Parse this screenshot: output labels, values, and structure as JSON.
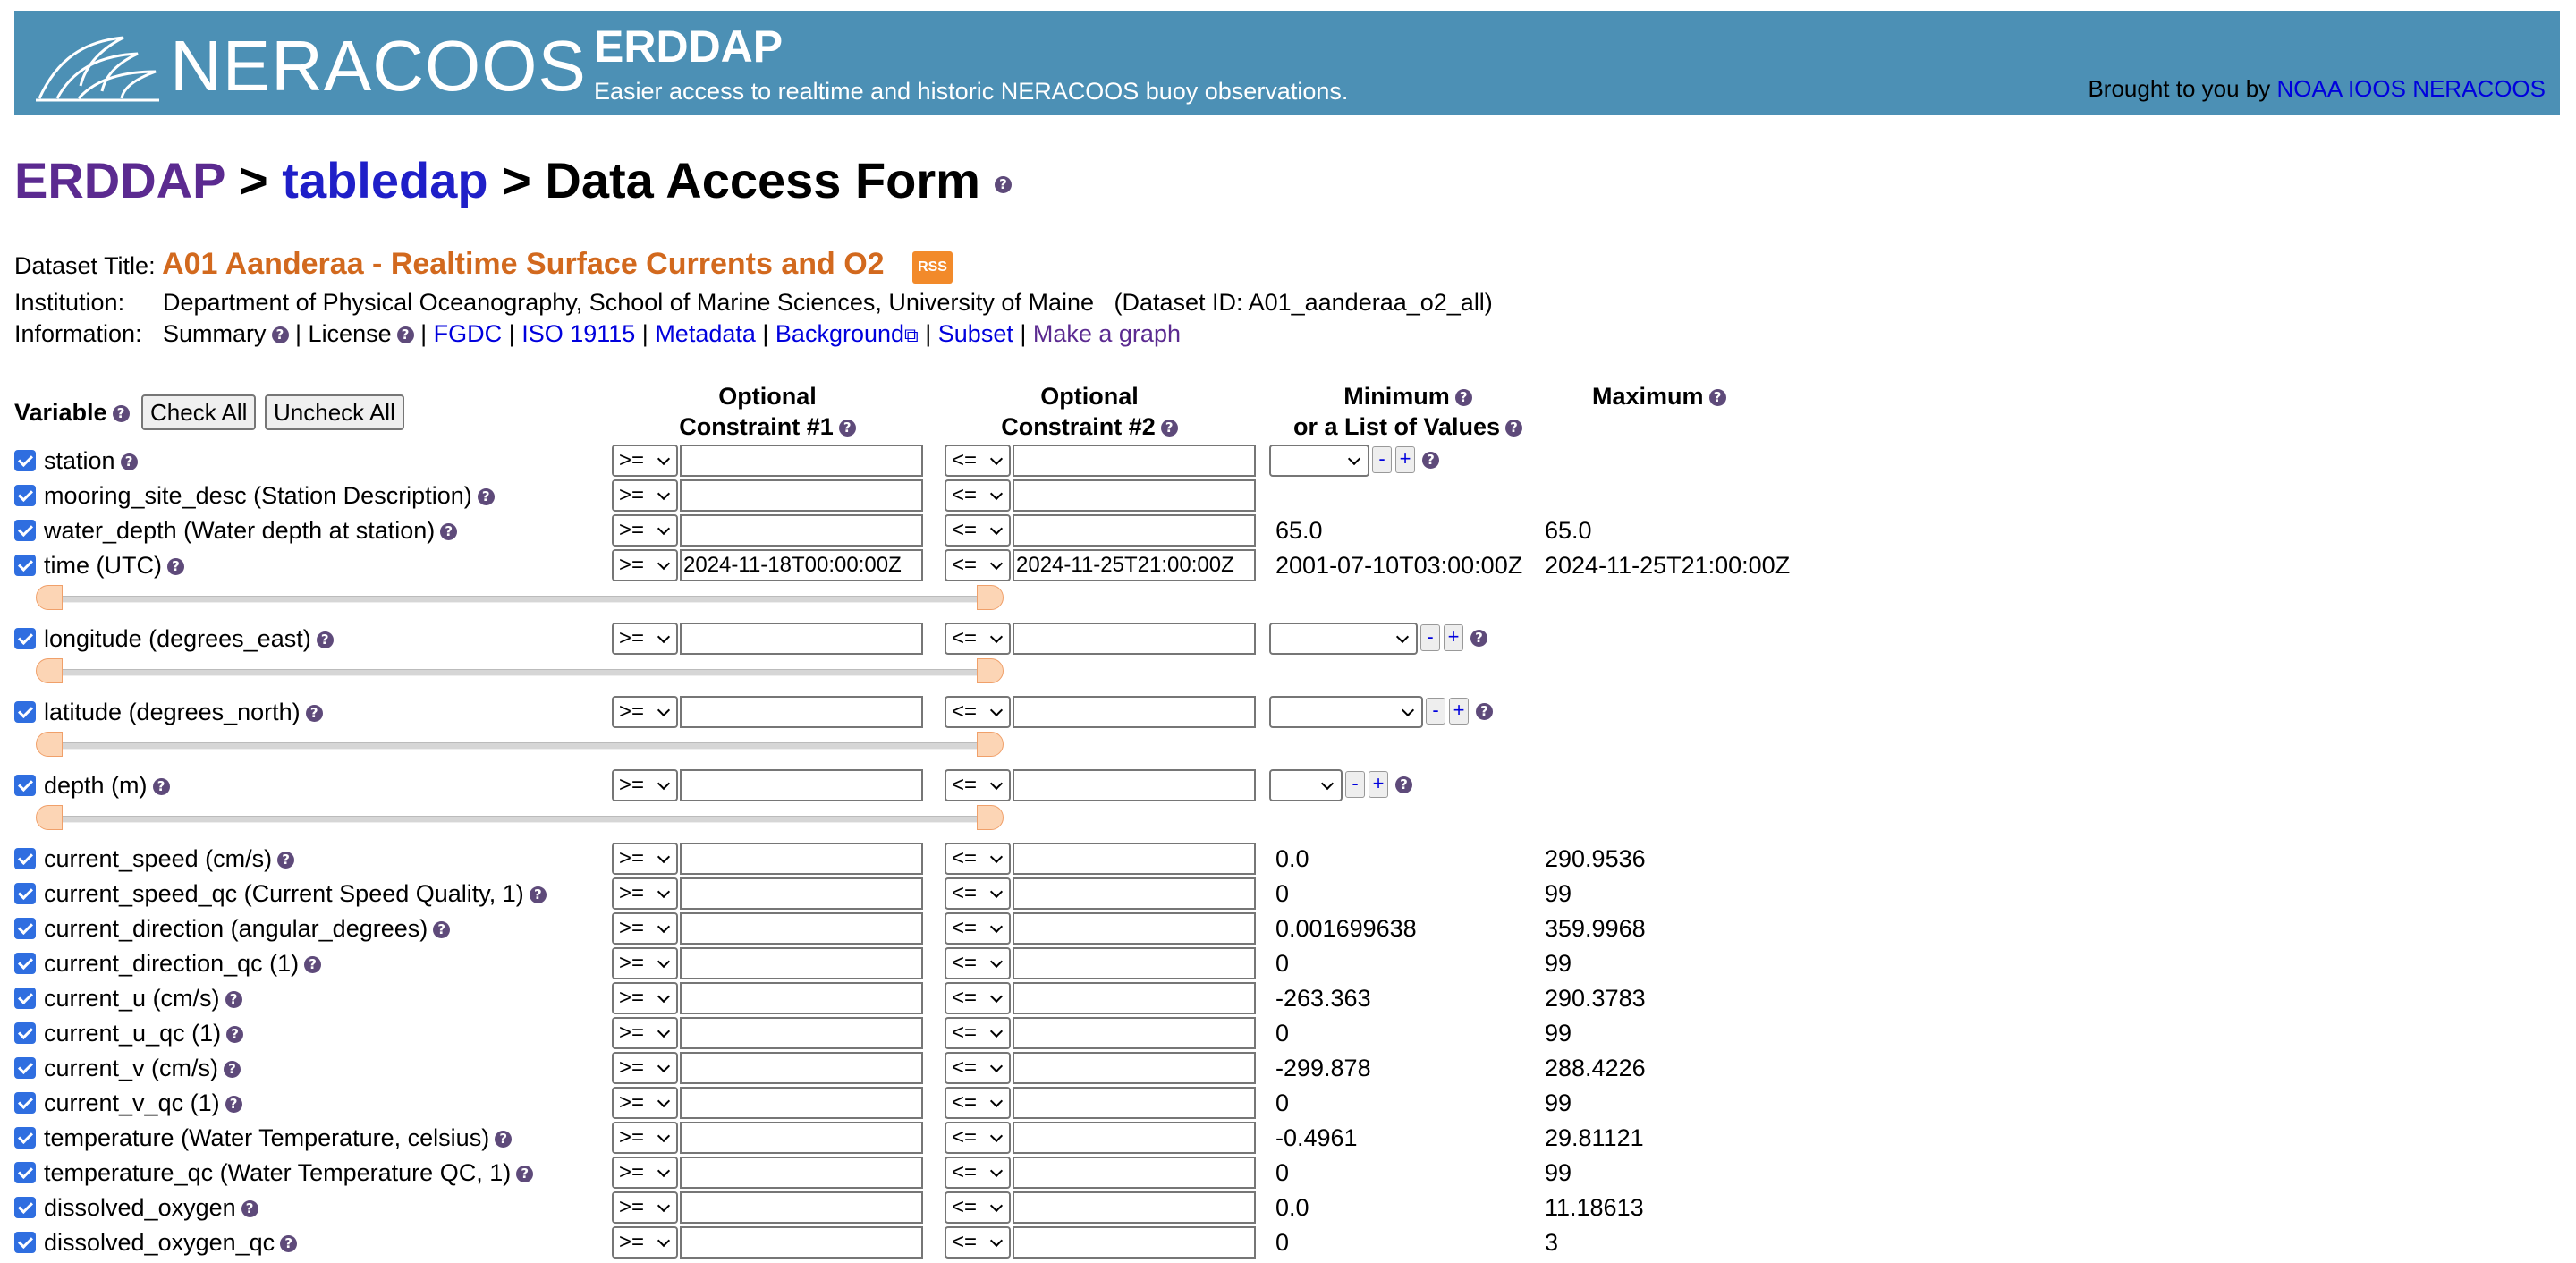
{
  "banner": {
    "logo_text": "NERACOOS",
    "title": "ERDDAP",
    "subtitle": "Easier access to realtime and historic NERACOOS buoy observations.",
    "brought_prefix": "Brought to you by",
    "brought_link": "NOAA IOOS NERACOOS"
  },
  "breadcrumb": {
    "erddap": "ERDDAP",
    "sep1": " > ",
    "tabledap": "tabledap",
    "sep2": " > ",
    "title": "Data Access Form"
  },
  "dataset": {
    "title_label": "Dataset Title:",
    "title": "A01 Aanderaa - Realtime Surface Currents and O2",
    "rss": "RSS",
    "institution_label": "Institution:",
    "institution": "Department of Physical Oceanography, School of Marine Sciences, University of Maine",
    "dataset_id": "(Dataset ID: A01_aanderaa_o2_all)",
    "information_label": "Information:",
    "links": {
      "summary": "Summary",
      "license": "License",
      "fgdc": "FGDC",
      "iso": "ISO 19115",
      "metadata": "Metadata",
      "background": "Background",
      "subset": "Subset",
      "graph": "Make a graph"
    }
  },
  "table_header": {
    "variable": "Variable",
    "check_all": "Check All",
    "uncheck_all": "Uncheck All",
    "c1_line1": "Optional",
    "c1_line2": "Constraint #1",
    "c2_line1": "Optional",
    "c2_line2": "Constraint #2",
    "min_line1": "Minimum",
    "min_line2": "or a List of Values",
    "max": "Maximum"
  },
  "operators": {
    "op1": ">=",
    "op2": "<="
  },
  "rows": [
    {
      "name": "station",
      "min": "",
      "max": ""
    },
    {
      "name": "mooring_site_desc (Station Description)",
      "min": "",
      "max": ""
    },
    {
      "name": "water_depth (Water depth at station)",
      "min": "65.0",
      "max": "65.0"
    },
    {
      "name": "time (UTC)",
      "c1": "2024-11-18T00:00:00Z",
      "c2": "2024-11-25T21:00:00Z",
      "min": "2001-07-10T03:00:00Z",
      "max": "2024-11-25T21:00:00Z"
    },
    {
      "name": "longitude (degrees_east)",
      "min": "",
      "max": ""
    },
    {
      "name": "latitude (degrees_north)",
      "min": "",
      "max": ""
    },
    {
      "name": "depth (m)",
      "min": "",
      "max": ""
    },
    {
      "name": "current_speed (cm/s)",
      "min": "0.0",
      "max": "290.9536"
    },
    {
      "name": "current_speed_qc (Current Speed Quality, 1)",
      "min": "0",
      "max": "99"
    },
    {
      "name": "current_direction (angular_degrees)",
      "min": "0.001699638",
      "max": "359.9968"
    },
    {
      "name": "current_direction_qc (1)",
      "min": "0",
      "max": "99"
    },
    {
      "name": "current_u (cm/s)",
      "min": "-263.363",
      "max": "290.3783"
    },
    {
      "name": "current_u_qc (1)",
      "min": "0",
      "max": "99"
    },
    {
      "name": "current_v (cm/s)",
      "min": "-299.878",
      "max": "288.4226"
    },
    {
      "name": "current_v_qc (1)",
      "min": "0",
      "max": "99"
    },
    {
      "name": "temperature (Water Temperature, celsius)",
      "min": "-0.4961",
      "max": "29.81121"
    },
    {
      "name": "temperature_qc (Water Temperature QC, 1)",
      "min": "0",
      "max": "99"
    },
    {
      "name": "dissolved_oxygen",
      "min": "0.0",
      "max": "11.18613"
    },
    {
      "name": "dissolved_oxygen_qc",
      "min": "0",
      "max": "3"
    }
  ],
  "colors": {
    "banner": "#4c90b5",
    "dataset_title": "#d2691e",
    "link": "#0000dd",
    "visited": "#5b2a90"
  }
}
